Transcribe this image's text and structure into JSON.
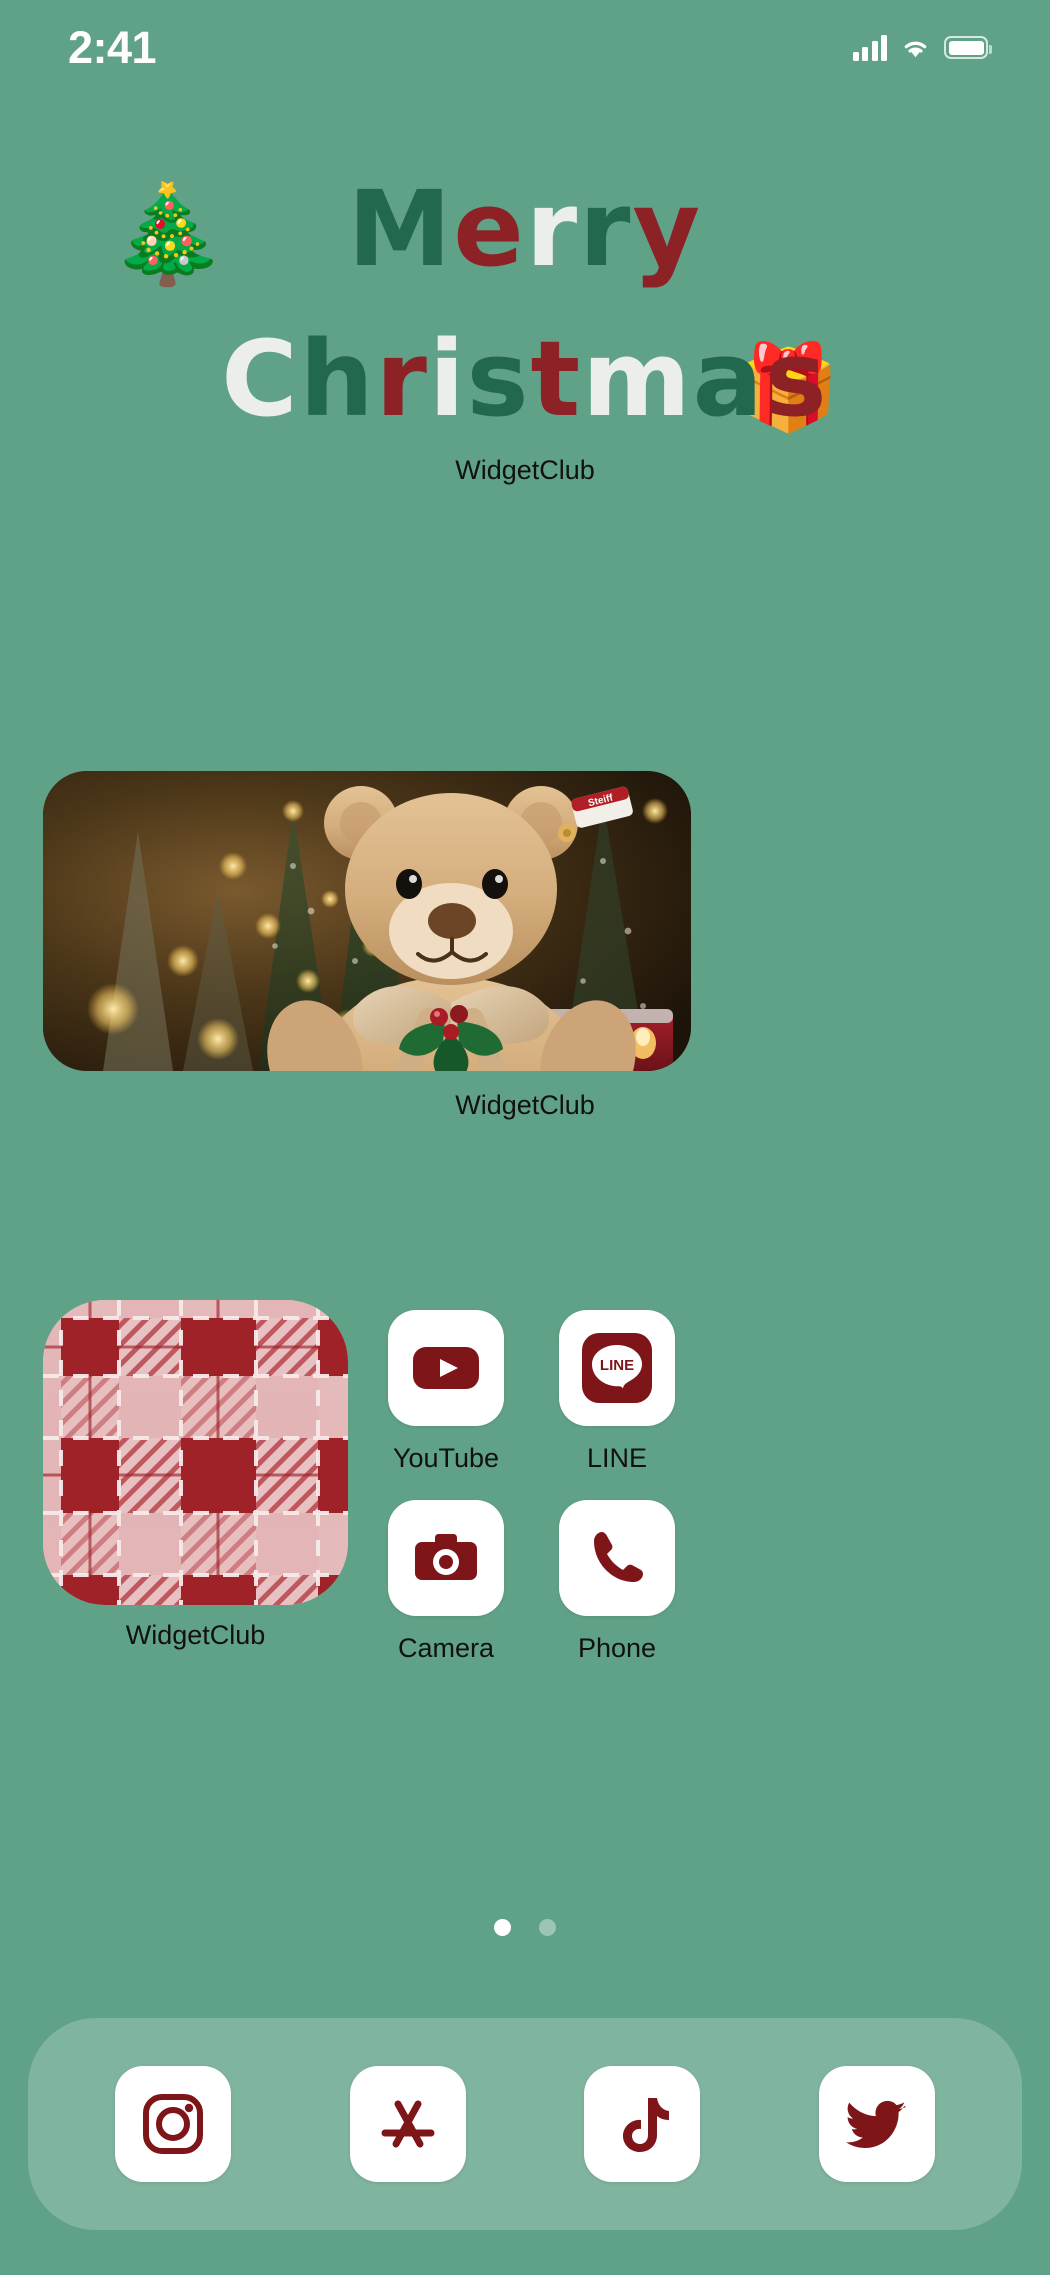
{
  "status_bar": {
    "time": "2:41",
    "signal_icon": "cellular-bars-icon",
    "wifi_icon": "wifi-icon",
    "battery_icon": "battery-full-icon"
  },
  "theme": {
    "background": "#60a287",
    "accent_red": "#8d2226",
    "accent_green": "#22684f",
    "accent_white": "#eceeeb",
    "tile_white": "#ffffff",
    "label_text": "#111111"
  },
  "header_widget": {
    "line1": "Merry",
    "line2": "Christmas",
    "line1_letters": [
      {
        "char": "M",
        "color": "green"
      },
      {
        "char": "e",
        "color": "red"
      },
      {
        "char": "r",
        "color": "white"
      },
      {
        "char": "r",
        "color": "green"
      },
      {
        "char": "y",
        "color": "red"
      }
    ],
    "line2_letters": [
      {
        "char": "C",
        "color": "white"
      },
      {
        "char": "h",
        "color": "green"
      },
      {
        "char": "r",
        "color": "red"
      },
      {
        "char": "i",
        "color": "white"
      },
      {
        "char": "s",
        "color": "green"
      },
      {
        "char": "t",
        "color": "red"
      },
      {
        "char": "m",
        "color": "white"
      },
      {
        "char": "a",
        "color": "green"
      },
      {
        "char": "s",
        "color": "red"
      }
    ],
    "tree_emoji": "🎄",
    "gift_emoji": "🎁",
    "label": "WidgetClub"
  },
  "photo_widget": {
    "label": "WidgetClub",
    "description": "teddy-bear-christmas-photo"
  },
  "plaid_widget": {
    "label": "WidgetClub",
    "description": "red-pink-plaid-pattern"
  },
  "apps": [
    {
      "name": "YouTube",
      "icon": "youtube-icon"
    },
    {
      "name": "LINE",
      "icon": "line-icon",
      "icon_text": "LINE"
    },
    {
      "name": "Camera",
      "icon": "camera-icon"
    },
    {
      "name": "Phone",
      "icon": "phone-icon"
    }
  ],
  "page_dots": {
    "count": 2,
    "active_index": 0
  },
  "dock": {
    "items": [
      {
        "name": "Instagram",
        "icon": "instagram-icon"
      },
      {
        "name": "App Store",
        "icon": "app-store-icon"
      },
      {
        "name": "TikTok",
        "icon": "tiktok-icon"
      },
      {
        "name": "Twitter",
        "icon": "twitter-icon"
      }
    ]
  }
}
